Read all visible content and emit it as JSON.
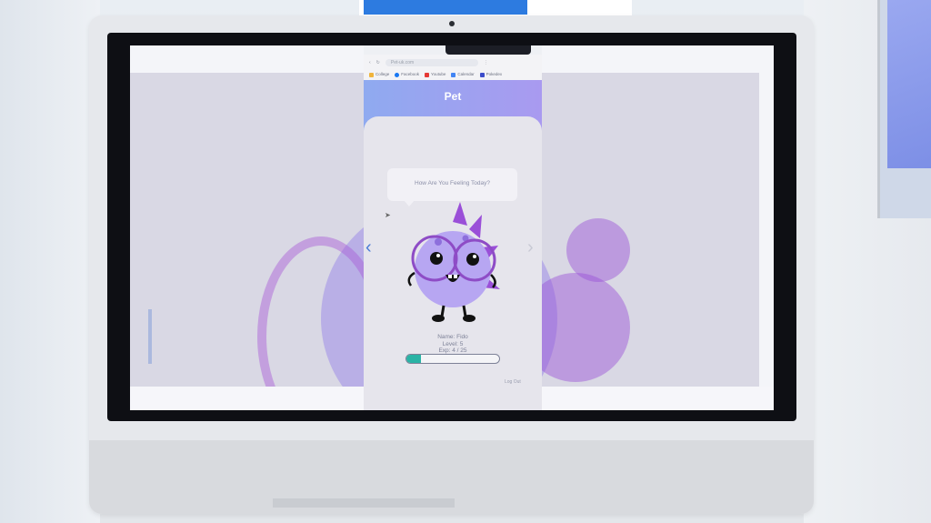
{
  "browser": {
    "url": "Pet-uk.com",
    "bookmarks": [
      {
        "label": "College",
        "color": "#f0b43c",
        "icon": "folder-icon"
      },
      {
        "label": "Facebook",
        "color": "#1877f2",
        "icon": "facebook-icon"
      },
      {
        "label": "Youtube",
        "color": "#e53935",
        "icon": "youtube-icon"
      },
      {
        "label": "Calendar",
        "color": "#4285f4",
        "icon": "calendar-icon"
      },
      {
        "label": "Pokedex",
        "color": "#3b4cca",
        "icon": "pokedex-icon"
      }
    ]
  },
  "app": {
    "title": "Pet",
    "bubble_text": "How Are You Feeling Today?",
    "pet_name": "Name: Fido",
    "pet_level": "Level: 5",
    "pet_exp": "Exp: 4 / 25",
    "exp_current": 4,
    "exp_max": 25,
    "logout_label": "Log Out",
    "nav_left_icon": "chevron-left-icon",
    "nav_right_icon": "chevron-right-icon"
  },
  "colors": {
    "header_gradient_start": "#8faaf0",
    "header_gradient_end": "#a99af0",
    "pet_body": "#b7a6f2",
    "pet_spikes": "#9a4fd8",
    "glasses": "#8e4cc6",
    "progress_fill": "#2ab3a5"
  }
}
